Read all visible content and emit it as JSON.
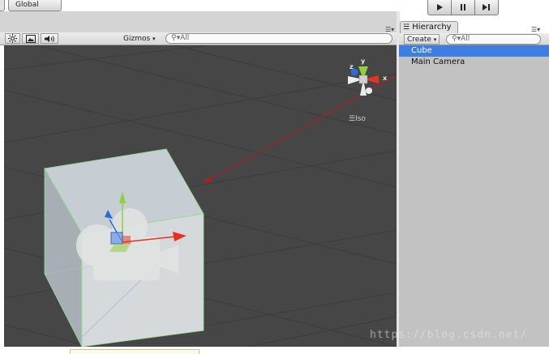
{
  "toolbar": {
    "global_label": "Global",
    "play_controls": [
      "play-icon",
      "pause-icon",
      "step-icon"
    ]
  },
  "scene": {
    "toolbar_icons": [
      "sun-icon",
      "image-icon",
      "speaker-icon"
    ],
    "gizmos_label": "Gizmos",
    "search_placeholder": "All",
    "orientation_gizmo": {
      "x_label": "x",
      "y_label": "y",
      "z_label": "z",
      "projection_label": "Iso"
    },
    "selected_object": "Cube",
    "camera_icon": "camera-gizmo-icon",
    "colors": {
      "background": "#464646",
      "x_axis": "#e8321f",
      "y_axis": "#8fd13a",
      "z_axis": "#2f6ad8",
      "selection_outline": "#8ee08e"
    }
  },
  "hierarchy": {
    "tab_label": "Hierarchy",
    "create_label": "Create",
    "search_placeholder": "All",
    "items": [
      {
        "label": "Cube",
        "selected": true
      },
      {
        "label": "Main Camera",
        "selected": false
      }
    ],
    "selection_color": "#3d7ee0"
  },
  "watermark": "https://blog.csdn.net/"
}
